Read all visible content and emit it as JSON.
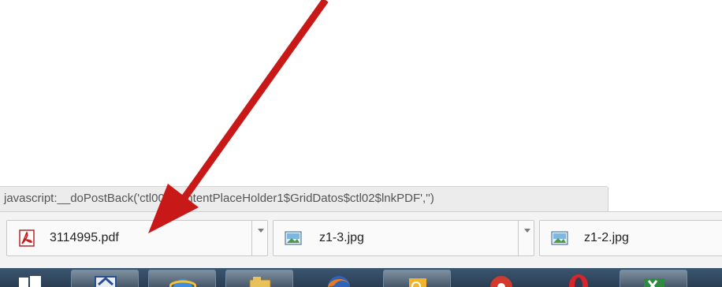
{
  "status_bar": {
    "url": "javascript:__doPostBack('ctl00$ContentPlaceHolder1$GridDatos$ctl02$lnkPDF','')"
  },
  "downloads": [
    {
      "filename": "3114995.pdf",
      "icon": "pdf-file-icon"
    },
    {
      "filename": "z1-3.jpg",
      "icon": "image-file-icon"
    },
    {
      "filename": "z1-2.jpg",
      "icon": "image-file-icon"
    }
  ],
  "annotation": {
    "color": "#c81818"
  },
  "taskbar": {
    "items": [
      "start-button",
      "windows-explorer-icon",
      "internet-explorer-icon",
      "file-manager-icon",
      "firefox-icon",
      "outlook-icon",
      "chrome-icon",
      "opera-icon",
      "excel-icon"
    ]
  }
}
